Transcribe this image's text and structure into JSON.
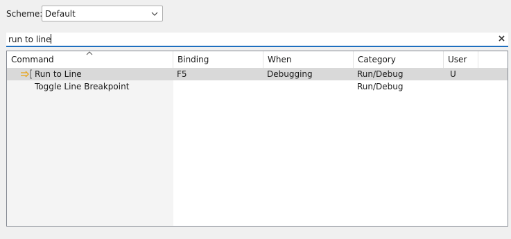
{
  "scheme": {
    "label": "Scheme:",
    "value": "Default"
  },
  "filter": {
    "value": "run to line"
  },
  "table": {
    "columns": [
      "Command",
      "Binding",
      "When",
      "Category",
      "User"
    ],
    "rows": [
      {
        "command": "Run to Line",
        "binding": "F5",
        "when": "Debugging",
        "category": "Run/Debug",
        "user": "U",
        "icon": "run-to-line-icon",
        "selected": true
      },
      {
        "command": "Toggle Line Breakpoint",
        "binding": "",
        "when": "",
        "category": "Run/Debug",
        "user": "",
        "icon": "",
        "selected": false
      }
    ]
  },
  "colors": {
    "selection": "#d9d9d9",
    "focus_accent": "#1e6fbf",
    "icon_accent": "#e8a317"
  }
}
